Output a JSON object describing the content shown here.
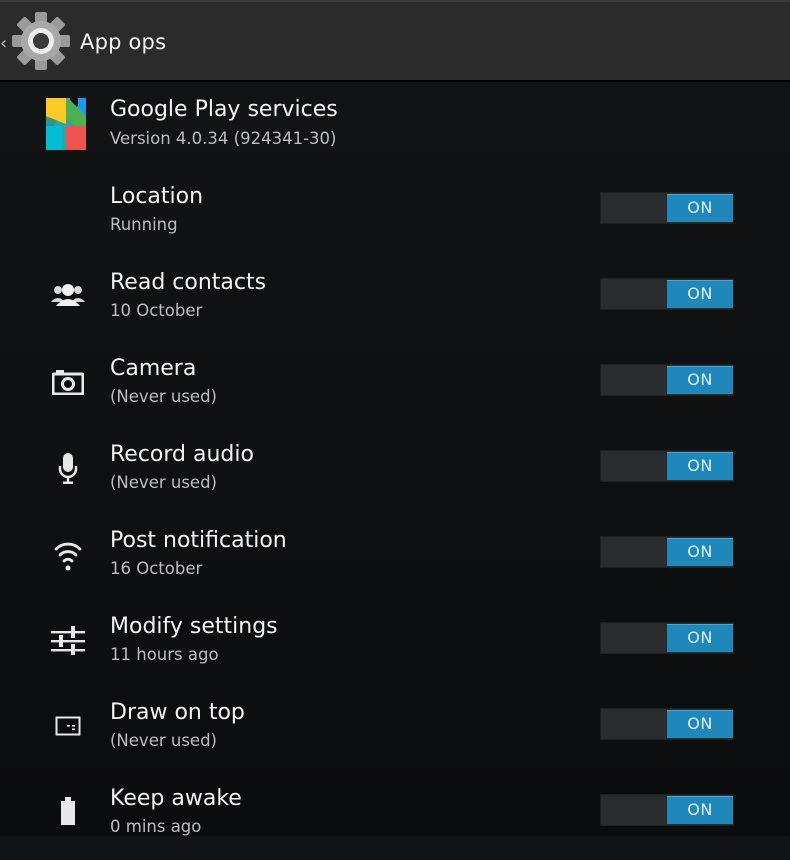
{
  "actionbar": {
    "title": "App ops",
    "up_glyph": "‹"
  },
  "app": {
    "name": "Google Play services",
    "version": "Version 4.0.34 (924341-30)"
  },
  "accent_color": "#1f87b9",
  "permissions": [
    {
      "icon": "location",
      "title": "Location",
      "sub": "Running",
      "toggle": "ON"
    },
    {
      "icon": "contacts-icon",
      "title": "Read contacts",
      "sub": "10 October",
      "toggle": "ON"
    },
    {
      "icon": "camera-icon",
      "title": "Camera",
      "sub": "(Never used)",
      "toggle": "ON"
    },
    {
      "icon": "microphone-icon",
      "title": "Record audio",
      "sub": "(Never used)",
      "toggle": "ON"
    },
    {
      "icon": "wifi-icon",
      "title": "Post notification",
      "sub": "16 October",
      "toggle": "ON"
    },
    {
      "icon": "sliders-icon",
      "title": "Modify settings",
      "sub": "11 hours ago",
      "toggle": "ON"
    },
    {
      "icon": "window-icon",
      "title": "Draw on top",
      "sub": "(Never used)",
      "toggle": "ON"
    },
    {
      "icon": "battery-icon",
      "title": "Keep awake",
      "sub": "0 mins ago",
      "toggle": "ON"
    }
  ]
}
